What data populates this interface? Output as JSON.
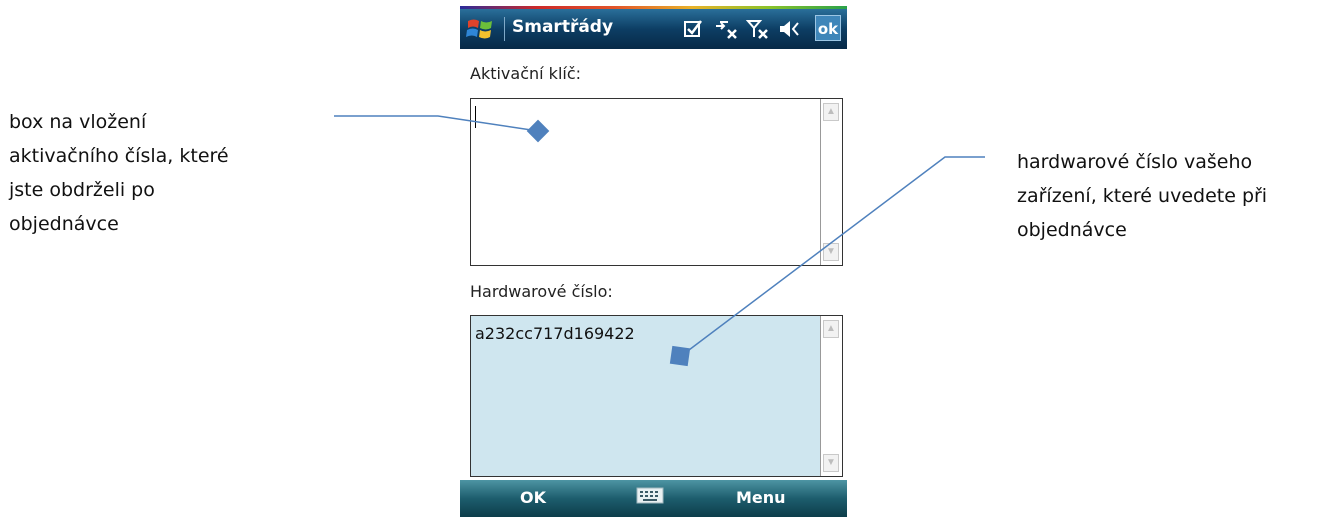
{
  "annotations": {
    "left": {
      "lines": [
        "box na vložení",
        "aktivačního čísla, které",
        "jste obdrželi po",
        "objednávce"
      ]
    },
    "right": {
      "lines": [
        "hardwarové číslo vašeho",
        "zařízení, které uvedete při",
        "objednávce"
      ]
    },
    "line_color": "#4f81bd"
  },
  "device": {
    "app_title": "Smartřády",
    "ok_button": "ok",
    "icons": [
      "windows-start-icon",
      "checkbox-icon",
      "connectivity-icon",
      "signal-off-icon",
      "volume-icon",
      "keyboard-icon"
    ]
  },
  "form": {
    "activation_key": {
      "label": "Aktivační klíč:",
      "value": ""
    },
    "hardware_number": {
      "label": "Hardwarové číslo:",
      "value": "a232cc717d169422"
    }
  },
  "softkeys": {
    "left": "OK",
    "right": "Menu"
  },
  "colors": {
    "titlebar": "#0d3e64",
    "softbar": "#1d5d6d",
    "hw_box_bg": "#cfe6ef"
  }
}
